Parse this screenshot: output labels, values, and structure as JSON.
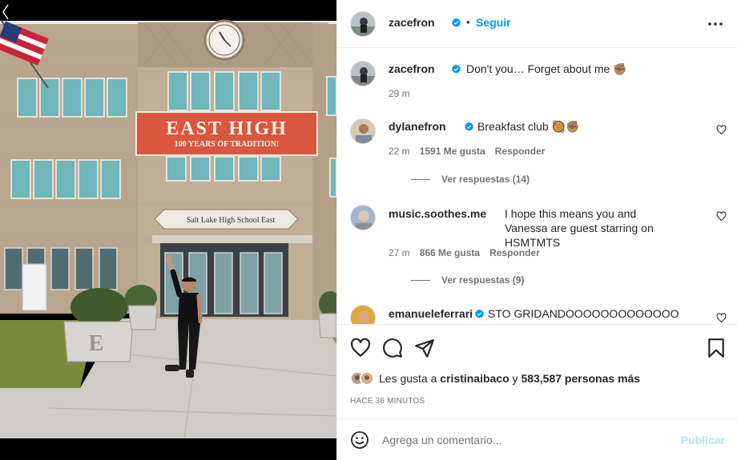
{
  "post": {
    "author": "zacefron",
    "follow_label": "Seguir",
    "separator": "•",
    "caption": "Don't you… Forget about me ✊🏽",
    "caption_time": "29 m",
    "more_icon": "more-horizontal-icon",
    "photo": {
      "banner_title": "EAST HIGH",
      "banner_subtitle": "100 YEARS OF TRADITION!",
      "sign_text": "Salt Lake High School East",
      "planter_letter": "E"
    }
  },
  "comments": [
    {
      "user": "dylanefron",
      "text": "Breakfast club 🥘✊🏽",
      "time": "22 m",
      "likes": "1591 Me gusta",
      "reply_label": "Responder",
      "replies_label": "Ver respuestas (14)"
    },
    {
      "user": "music.soothes.me",
      "text": "I hope this means you and Vanessa are guest starring on HSMTMTS",
      "time": "27 m",
      "likes": "866 Me gusta",
      "reply_label": "Responder",
      "replies_label": "Ver respuestas (9)"
    },
    {
      "user": "emanueleferrari",
      "text": "STO GRIDANDOOOOOOOOOOOOO"
    }
  ],
  "actions": {
    "like_icon": "heart-icon",
    "comment_icon": "comment-icon",
    "share_icon": "send-icon",
    "save_icon": "bookmark-icon",
    "liked_prefix": "Les gusta a",
    "liked_user": "cristinaibaco",
    "liked_and": "y",
    "liked_count": "583,587 personas más",
    "time_ago": "HACE 36 MINUTOS"
  },
  "composer": {
    "placeholder": "Agrega un comentario...",
    "publish_label": "Publicar",
    "emoji_icon": "emoji-icon"
  },
  "colors": {
    "accent": "#0095f6",
    "publish_disabled": "#b2dffc",
    "verified": "#0095f6",
    "banner": "#d9573e"
  }
}
